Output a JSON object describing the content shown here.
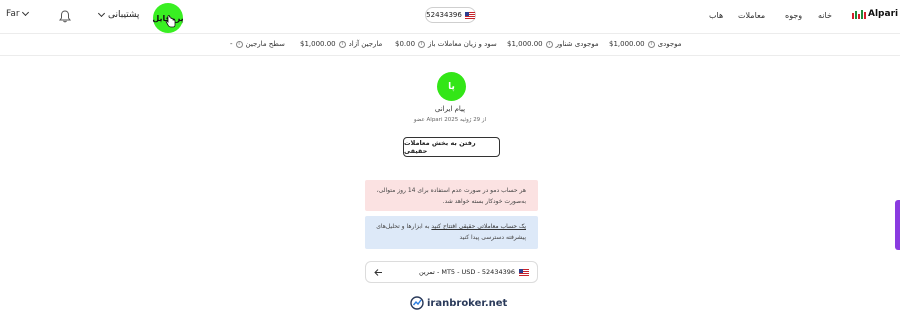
{
  "header": {
    "language": "Far",
    "support_label": "پشتیبانی",
    "profile_label": "پروفایل",
    "account_number": "52434396",
    "nav": [
      "خانه",
      "وجوه",
      "معاملات",
      "هاب"
    ],
    "logo_text": "Alpari"
  },
  "stats": [
    {
      "label": "موجودی",
      "value": "$1,000.00"
    },
    {
      "label": "موجودی شناور",
      "value": "$1,000.00"
    },
    {
      "label": "سود و زیان معاملات باز",
      "value": "$0.00"
    },
    {
      "label": "مارجین آزاد",
      "value": "$1,000.00"
    },
    {
      "label": "سطح مارجین",
      "value": "-"
    }
  ],
  "user": {
    "avatar_letter": "پا",
    "name": "پیام ایرانی",
    "member_since": "عضو Alpari از 29 ژوئیه 2025"
  },
  "actions": {
    "go_real": "رفتن به بخش معاملات حقیقی"
  },
  "alerts": {
    "demo_warning": "هر حساب دمو در صورت عدم استفاده برای 14 روز متوالی، به‌صورت خودکار بسته خواهد شد.",
    "real_link": "یک حساب معاملاتی حقیقی افتتاح کنید",
    "real_rest": " به ابزارها و تحلیل‌های پیشرفته دسترسی پیدا کنید"
  },
  "account_row": {
    "label": "تمرین - MT5 - USD - 52434396"
  },
  "footer": {
    "brand": "iranbroker.net"
  },
  "colors": {
    "accent_green": "#33e617",
    "alert_red_bg": "#fbe2e2",
    "alert_blue_bg": "#dde9f8",
    "side_tab": "#8a3be0"
  }
}
